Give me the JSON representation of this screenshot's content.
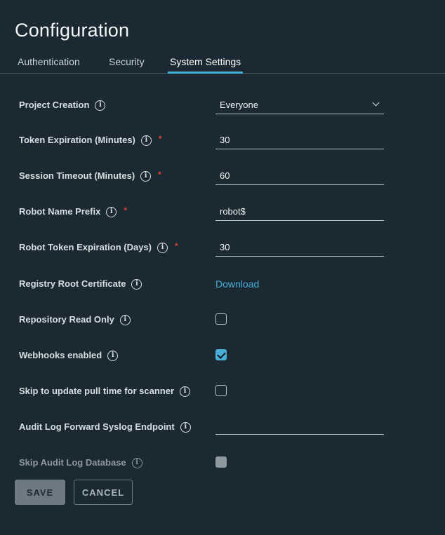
{
  "page": {
    "title": "Configuration"
  },
  "tabs": [
    {
      "label": "Authentication",
      "active": false
    },
    {
      "label": "Security",
      "active": false
    },
    {
      "label": "System Settings",
      "active": true
    }
  ],
  "settings": {
    "project_creation": {
      "label": "Project Creation",
      "value": "Everyone",
      "options": [
        "Everyone"
      ]
    },
    "token_expiration": {
      "label": "Token Expiration (Minutes)",
      "required": "*",
      "value": "30"
    },
    "session_timeout": {
      "label": "Session Timeout (Minutes)",
      "required": "*",
      "value": "60"
    },
    "robot_name_prefix": {
      "label": "Robot Name Prefix",
      "required": "*",
      "value": "robot$"
    },
    "robot_token_expiration": {
      "label": "Robot Token Expiration (Days)",
      "required": "*",
      "value": "30"
    },
    "registry_root_certificate": {
      "label": "Registry Root Certificate",
      "link": "Download"
    },
    "repository_read_only": {
      "label": "Repository Read Only",
      "checked": false
    },
    "webhooks_enabled": {
      "label": "Webhooks enabled",
      "checked": true
    },
    "skip_pull_time": {
      "label": "Skip to update pull time for scanner",
      "checked": false
    },
    "audit_log_endpoint": {
      "label": "Audit Log Forward Syslog Endpoint",
      "value": ""
    },
    "skip_audit_log_db": {
      "label": "Skip Audit Log Database",
      "checked": false,
      "disabled": true
    }
  },
  "actions": {
    "save_label": "SAVE",
    "cancel_label": "CANCEL"
  },
  "icons": {
    "info": "info-icon",
    "chevron": "chevron-down-icon",
    "check": "checkmark-icon"
  },
  "colors": {
    "accent": "#49afd9",
    "background": "#1b2a32",
    "required": "#e0443a"
  }
}
